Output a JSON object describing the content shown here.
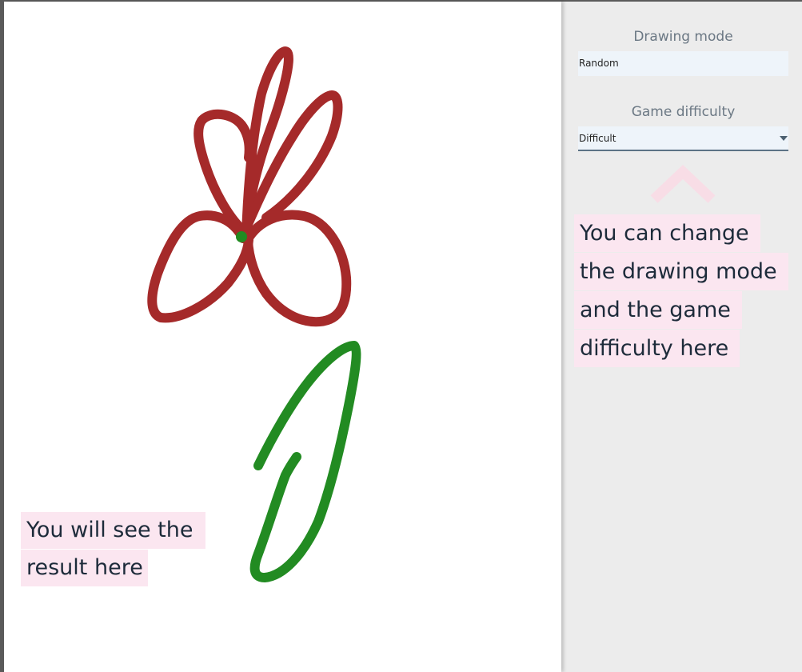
{
  "canvas": {
    "hint_line1": "You will see the",
    "hint_line2": "result here"
  },
  "panel": {
    "drawing_mode_label": "Drawing mode",
    "drawing_mode_value": "Random",
    "difficulty_label": "Game difficulty",
    "difficulty_value": "Difficult",
    "hint_lines": [
      "You can change",
      "the drawing mode",
      "and the game",
      "difficulty here"
    ]
  },
  "colors": {
    "flower": "#a52a2a",
    "stem": "#228b22",
    "highlight": "#fbe6f0",
    "chevron": "#f8dde6"
  },
  "icons": [
    "chevron-up-icon",
    "chevron-down-icon"
  ]
}
